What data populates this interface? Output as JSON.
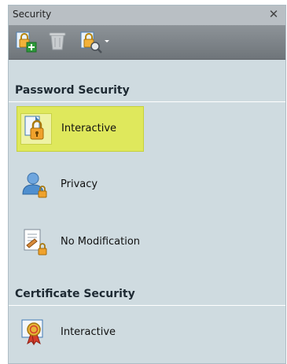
{
  "panel": {
    "title": "Security",
    "close_glyph": "✕"
  },
  "toolbar": {
    "buttons": [
      {
        "name": "add-security-button",
        "icon": "lock-add-icon"
      },
      {
        "name": "delete-security-button",
        "icon": "trash-icon",
        "disabled": true
      },
      {
        "name": "security-settings-button",
        "icon": "lock-settings-icon",
        "has_dropdown": true
      }
    ]
  },
  "sections": [
    {
      "header": "Password Security",
      "items": [
        {
          "label": "Interactive",
          "icon": "lock-document-icon",
          "selected": true
        },
        {
          "label": "Privacy",
          "icon": "user-lock-icon",
          "selected": false
        },
        {
          "label": "No Modification",
          "icon": "document-edit-lock-icon",
          "selected": false
        }
      ]
    },
    {
      "header": "Certificate Security",
      "items": [
        {
          "label": "Interactive",
          "icon": "certificate-ribbon-icon",
          "selected": false
        }
      ]
    }
  ],
  "colors": {
    "selected_bg": "#dfe85c",
    "panel_bg": "#cfdbe0",
    "toolbar_bg": "#7d8388"
  }
}
